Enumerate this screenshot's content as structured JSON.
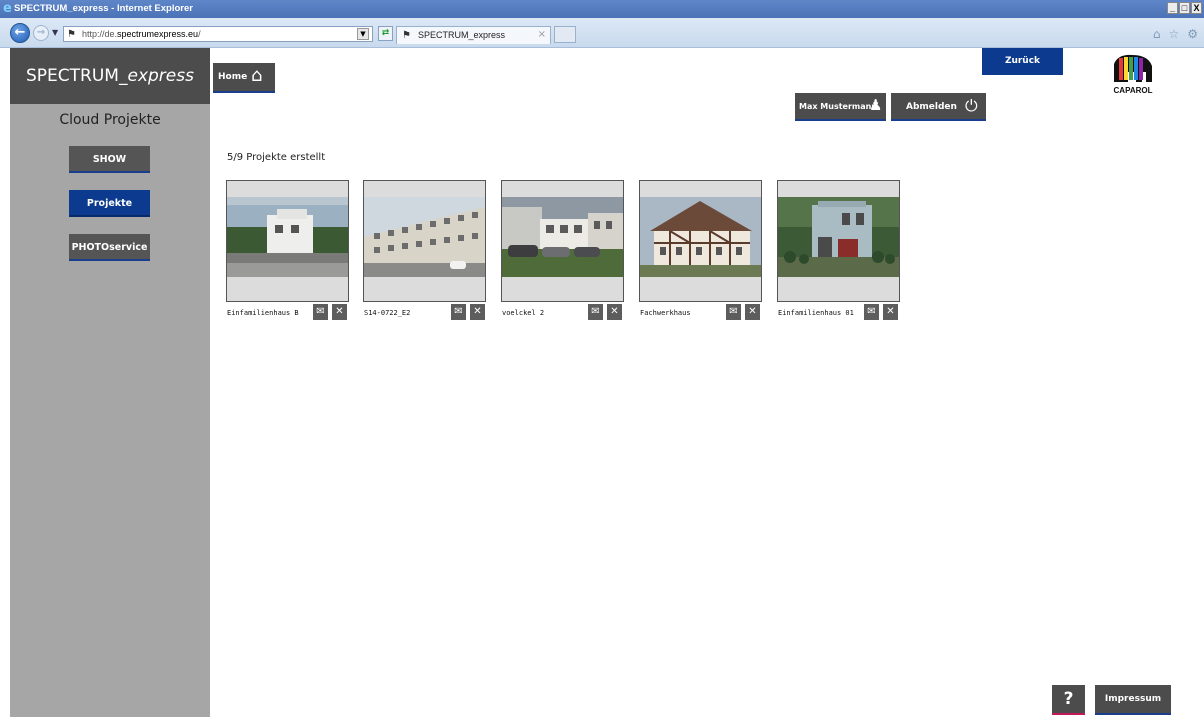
{
  "browser": {
    "window_title": "SPECTRUM_express - Internet Explorer",
    "address_url_prefix": "http://de.",
    "address_url_domain": "spectrumexpress.eu",
    "address_url_suffix": "/",
    "tab_title": "SPECTRUM_express",
    "window_controls": [
      "_",
      "□",
      "X"
    ]
  },
  "sidebar": {
    "brand_main": "SPECTRUM_",
    "brand_italic": "express",
    "section_title": "Cloud Projekte",
    "items": [
      {
        "label": "SHOW",
        "active": false
      },
      {
        "label": "Projekte",
        "active": true
      },
      {
        "label": "PHOTOservice",
        "active": false
      }
    ]
  },
  "header": {
    "home_label": "Home",
    "back_label": "Zurück",
    "user_label": "Max Mustermann",
    "logout_label": "Abmelden",
    "logo_text": "CAPAROL"
  },
  "main": {
    "count_label": "5/9 Projekte erstellt",
    "projects": [
      {
        "name": "Einfamilienhaus B"
      },
      {
        "name": "S14-0722_E2"
      },
      {
        "name": "voelckel 2"
      },
      {
        "name": "Fachwerkhaus"
      },
      {
        "name": "Einfamilienhaus 01"
      }
    ]
  },
  "footer": {
    "help_label": "?",
    "impressum_label": "Impressum"
  },
  "colors": {
    "accent_blue": "#0b3a8e",
    "button_dark": "#4c4c4c",
    "sidebar_gray": "#a6a6a6"
  }
}
